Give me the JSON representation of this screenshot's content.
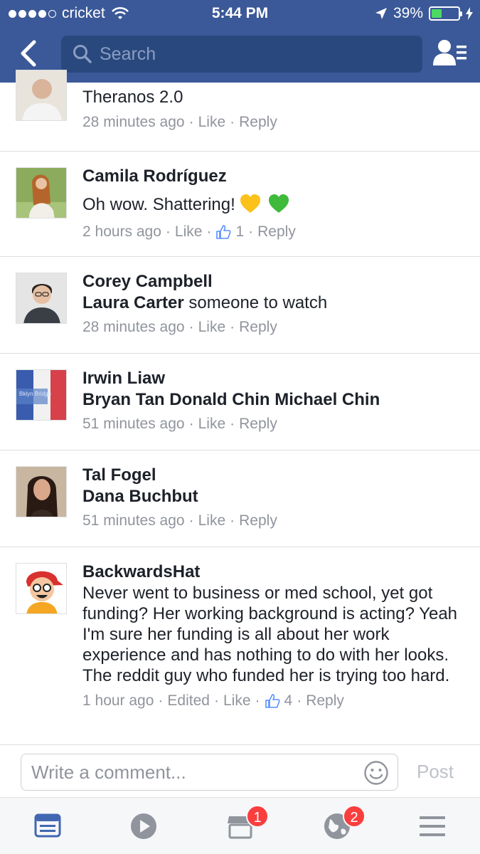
{
  "status_bar": {
    "carrier": "cricket",
    "time": "5:44 PM",
    "battery_percent": "39%",
    "battery_level": 0.39,
    "signal_bars": 4
  },
  "nav": {
    "back_icon": "chevron-left-icon",
    "search_placeholder": "Search",
    "friends_icon": "friend-list-icon"
  },
  "comments": [
    {
      "name": "",
      "text": "Theranos 2.0",
      "meta": {
        "time": "28 minutes ago",
        "like": "Like",
        "reply": "Reply"
      }
    },
    {
      "name": "Camila Rodríguez",
      "text": "Oh wow. Shattering!",
      "emoji": [
        "yellow-heart",
        "green-heart"
      ],
      "meta": {
        "time": "2 hours ago",
        "like": "Like",
        "likes_count": "1",
        "reply": "Reply"
      }
    },
    {
      "name": "Corey Campbell",
      "tag": "Laura Carter",
      "text": "someone to watch",
      "meta": {
        "time": "28 minutes ago",
        "like": "Like",
        "reply": "Reply"
      }
    },
    {
      "name": "Irwin Liaw",
      "tag": "Bryan Tan Donald Chin Michael Chin",
      "avatar_text": "Bklyn Bridge",
      "meta": {
        "time": "51 minutes ago",
        "like": "Like",
        "reply": "Reply"
      }
    },
    {
      "name": "Tal Fogel",
      "tag": "Dana Buchbut",
      "meta": {
        "time": "51 minutes ago",
        "like": "Like",
        "reply": "Reply"
      }
    },
    {
      "name": "BackwardsHat",
      "text": "Never went to business or med school, yet got funding? Her working background is acting? Yeah I'm sure her funding is all about her work experience and has nothing to do with her looks. The reddit guy who funded her is trying too hard.",
      "meta": {
        "time": "1 hour ago",
        "edited": "Edited",
        "like": "Like",
        "likes_count": "4",
        "reply": "Reply"
      }
    }
  ],
  "composer": {
    "placeholder": "Write a comment...",
    "post_label": "Post"
  },
  "tab_bar": {
    "tabs": [
      {
        "icon": "news-feed-icon",
        "badge": ""
      },
      {
        "icon": "video-play-icon",
        "badge": ""
      },
      {
        "icon": "marketplace-icon",
        "badge": "1"
      },
      {
        "icon": "notifications-globe-icon",
        "badge": "2"
      },
      {
        "icon": "menu-icon",
        "badge": ""
      }
    ]
  },
  "colors": {
    "brand": "#3b5998",
    "search_bg": "#29487d",
    "meta_grey": "#90949c",
    "badge_red": "#fa3e3e",
    "battery_green": "#4cd964"
  }
}
